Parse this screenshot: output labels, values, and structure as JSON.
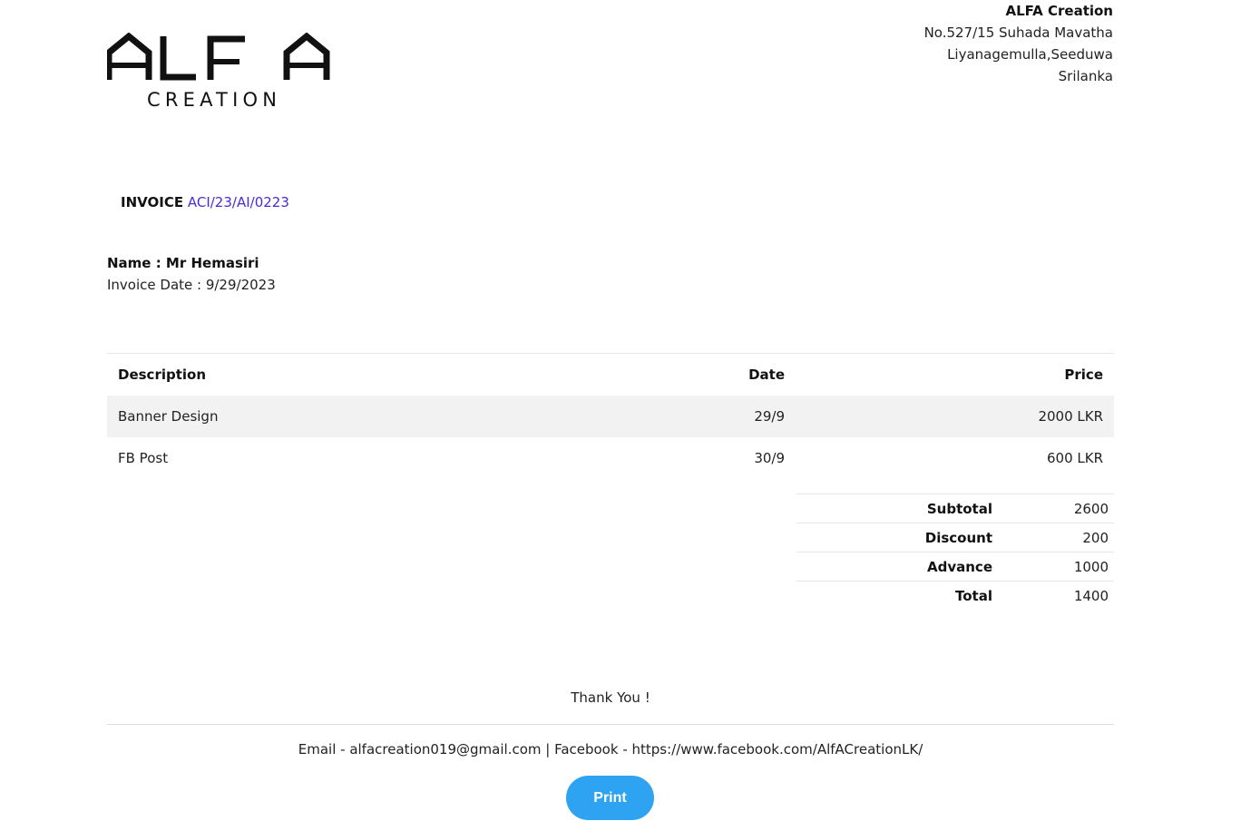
{
  "logo": {
    "main": "ALFA",
    "sub": "CREATION"
  },
  "company": {
    "name": "ALFA Creation",
    "address1": "No.527/15 Suhada Mavatha",
    "address2": "Liyanagemulla,Seeduwa",
    "country": "Srilanka"
  },
  "invoice": {
    "label": "INVOICE",
    "number": "ACI/23/AI/0223"
  },
  "customer": {
    "name": "Name : Mr Hemasiri",
    "date": "Invoice Date : 9/29/2023"
  },
  "table": {
    "headers": {
      "description": "Description",
      "date": "Date",
      "price": "Price"
    },
    "rows": [
      {
        "description": "Banner Design",
        "date": "29/9",
        "price": "2000 LKR"
      },
      {
        "description": "FB Post",
        "date": "30/9",
        "price": "600 LKR"
      }
    ]
  },
  "totals": [
    {
      "label": "Subtotal",
      "value": "2600"
    },
    {
      "label": "Discount",
      "value": "200"
    },
    {
      "label": "Advance",
      "value": "1000"
    },
    {
      "label": "Total",
      "value": "1400"
    }
  ],
  "thanks": "Thank You !",
  "footer": "Email - alfacreation019@gmail.com | Facebook - https://www.facebook.com/AlfACreationLK/",
  "print_label": "Print",
  "colors": {
    "invoice_number": "#4b2bd6",
    "print_button": "#2ea3f2"
  }
}
